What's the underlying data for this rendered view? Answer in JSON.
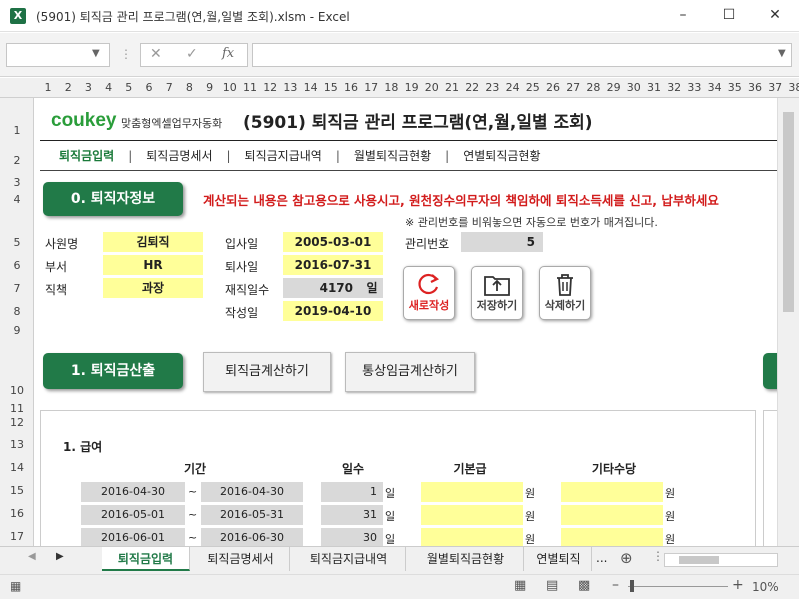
{
  "window": {
    "title": "(5901) 퇴직금 관리 프로그램(연,월,일별 조회).xlsm - Excel",
    "app_icon": "X"
  },
  "formula_bar": {
    "fn_label": "fx"
  },
  "columns": [
    "1",
    "2",
    "3",
    "4",
    "5",
    "6",
    "7",
    "8",
    "9",
    "10",
    "11",
    "12",
    "13",
    "14",
    "15",
    "16",
    "17",
    "18",
    "19",
    "20",
    "21",
    "22",
    "23",
    "24",
    "25",
    "26",
    "27",
    "28",
    "29",
    "30",
    "31",
    "32",
    "33",
    "34",
    "35",
    "36",
    "37",
    "38"
  ],
  "rows": [
    "1",
    "2",
    "3",
    "4",
    "5",
    "6",
    "7",
    "8",
    "9",
    "10",
    "11",
    "12",
    "13",
    "14",
    "15",
    "16",
    "17"
  ],
  "header": {
    "logo": "coukey",
    "logo_sub": "맞춤형엑셀업무자동화",
    "title": "(5901) 퇴직금 관리 프로그램(연,월,일별 조회)"
  },
  "menu": [
    "퇴직금입력",
    "퇴직금명세서",
    "퇴직금지급내역",
    "월별퇴직금현황",
    "연별퇴직금현황"
  ],
  "menu_sep": "|",
  "section0": {
    "title": "0. 퇴직자정보",
    "notice": "계산되는 내용은 참고용으로 사용시고, 원천징수의무자의 책임하에 퇴직소득세를 신고, 납부하세요",
    "note": "※ 관리번호를 비워놓으면 자동으로 번호가 매겨집니다."
  },
  "employee": {
    "name_label": "사원명",
    "name": "김퇴직",
    "dept_label": "부서",
    "dept": "HR",
    "pos_label": "직책",
    "pos": "과장",
    "join_label": "입사일",
    "join": "2005-03-01",
    "leave_label": "퇴사일",
    "leave": "2016-07-31",
    "days_label": "재직일수",
    "days": "4170",
    "days_unit": "일",
    "written_label": "작성일",
    "written": "2019-04-10",
    "mgmt_label": "관리번호",
    "mgmt": "5"
  },
  "actions": {
    "new": "새로작성",
    "save": "저장하기",
    "delete": "삭제하기"
  },
  "section1": {
    "title": "1. 퇴직금산출",
    "calc_btn": "퇴직금계산하기",
    "ordinary_btn": "통상임금계산하기"
  },
  "wage_table": {
    "label": "1. 급여",
    "headers": {
      "period": "기간",
      "days": "일수",
      "base": "기본급",
      "other": "기타수당"
    },
    "tilde": "~",
    "day_unit": "일",
    "won_unit": "원",
    "rows": [
      {
        "from": "2016-04-30",
        "to": "2016-04-30",
        "days": "1"
      },
      {
        "from": "2016-05-01",
        "to": "2016-05-31",
        "days": "31"
      },
      {
        "from": "2016-06-01",
        "to": "2016-06-30",
        "days": "30"
      }
    ]
  },
  "sheet_tabs": [
    "퇴직금입력",
    "퇴직금명세서",
    "퇴직금지급내역",
    "월별퇴직금현황",
    "연별퇴직"
  ],
  "tab_more": "...",
  "status": {
    "zoom": "10%"
  },
  "colors": {
    "excel_green": "#217a48",
    "highlight_yellow": "#ffff99",
    "notice_red": "#d21c1c"
  }
}
